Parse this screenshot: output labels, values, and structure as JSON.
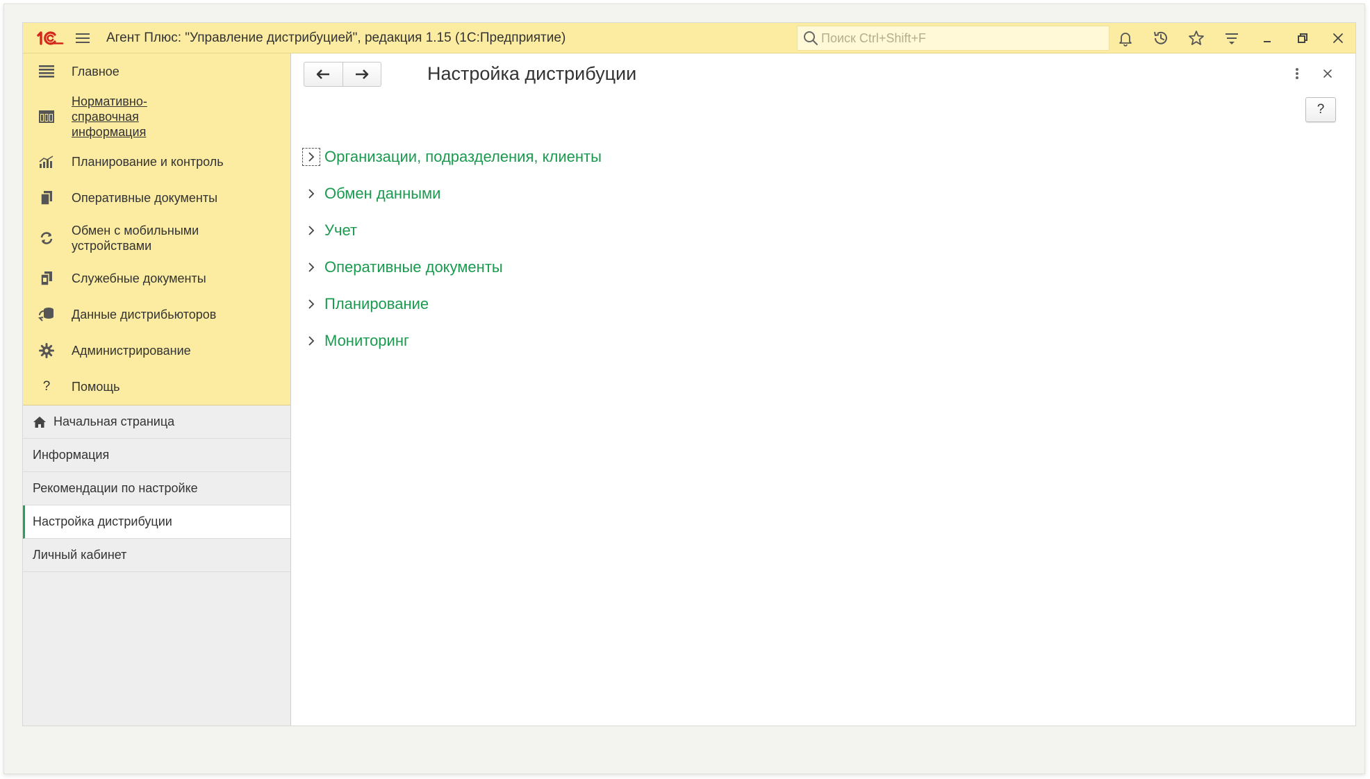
{
  "app": {
    "title": "Агент Плюс: \"Управление дистрибуцией\", редакция 1.15  (1С:Предприятие)"
  },
  "search": {
    "placeholder": "Поиск Ctrl+Shift+F"
  },
  "toolbar_icons": [
    "bell-icon",
    "history-icon",
    "star-icon",
    "funnel-icon",
    "minimize-icon",
    "restore-icon",
    "close-icon"
  ],
  "sections": [
    {
      "label": "Главное",
      "icon": "list-icon"
    },
    {
      "label": "Нормативно-справочная информация",
      "icon": "catalog-icon"
    },
    {
      "label": "Планирование и контроль",
      "icon": "chart-icon"
    },
    {
      "label": "Оперативные документы",
      "icon": "documents-icon"
    },
    {
      "label": "Обмен с мобильными устройствами",
      "icon": "sync-icon"
    },
    {
      "label": "Служебные документы",
      "icon": "service-documents-icon"
    },
    {
      "label": "Данные дистрибьюторов",
      "icon": "distributor-data-icon"
    },
    {
      "label": "Администрирование",
      "icon": "gear-icon"
    },
    {
      "label": "Помощь",
      "icon": "question-icon"
    }
  ],
  "nav": [
    {
      "label": "Начальная страница"
    },
    {
      "label": "Информация"
    },
    {
      "label": "Рекомендации по настройке"
    },
    {
      "label": "Настройка дистрибуции",
      "active": true
    },
    {
      "label": "Личный кабинет"
    }
  ],
  "page": {
    "title": "Настройка дистрибуции",
    "help_label": "?"
  },
  "groups": [
    {
      "label": "Организации, подразделения, клиенты"
    },
    {
      "label": "Обмен данными"
    },
    {
      "label": "Учет"
    },
    {
      "label": "Оперативные документы"
    },
    {
      "label": "Планирование"
    },
    {
      "label": "Мониторинг"
    }
  ],
  "colors": {
    "accent_yellow": "#fbeca1",
    "link_green": "#1a9a4e",
    "active_marker": "#2ca05a",
    "logo_red": "#d4261c"
  }
}
